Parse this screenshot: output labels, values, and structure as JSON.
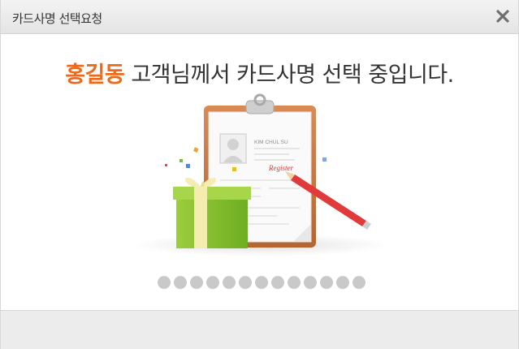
{
  "window": {
    "title": "카드사명 선택요청",
    "close_icon": "close-icon"
  },
  "headline": {
    "customer_name": "홍길동",
    "message": " 고객님께서 카드사명 선택 중입니다."
  },
  "illustration": {
    "form_name": "KIM CHUL SU",
    "stamp_text": "Register",
    "icons": [
      "clipboard-icon",
      "gift-box-icon",
      "pencil-icon",
      "profile-photo-icon"
    ]
  },
  "progress": {
    "total_dots": 13,
    "active_dot": null
  },
  "colors": {
    "accent": "#ee6a1a",
    "text": "#333333",
    "dot": "#c9c9c9",
    "footer": "#ececec"
  }
}
